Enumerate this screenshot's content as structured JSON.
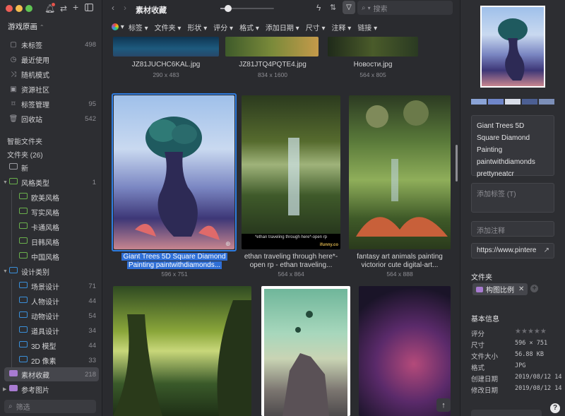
{
  "sidebar": {
    "library_name": "游戏原画",
    "items": [
      {
        "label": "未标签",
        "count": "498"
      },
      {
        "label": "最近使用",
        "count": ""
      },
      {
        "label": "随机模式",
        "count": ""
      },
      {
        "label": "资源社区",
        "count": ""
      },
      {
        "label": "标签管理",
        "count": "95"
      },
      {
        "label": "回收站",
        "count": "542"
      }
    ],
    "smart_folders_label": "智能文件夹",
    "folders_label": "文件夹 (26)",
    "folders": [
      {
        "label": "新",
        "count": ""
      },
      {
        "label": "风格类型",
        "count": "1"
      },
      {
        "label": "欧美风格",
        "count": ""
      },
      {
        "label": "写实风格",
        "count": ""
      },
      {
        "label": "卡通风格",
        "count": ""
      },
      {
        "label": "日韩风格",
        "count": ""
      },
      {
        "label": "中国风格",
        "count": ""
      },
      {
        "label": "设计类别",
        "count": ""
      },
      {
        "label": "场景设计",
        "count": "71"
      },
      {
        "label": "人物设计",
        "count": "44"
      },
      {
        "label": "动物设计",
        "count": "54"
      },
      {
        "label": "道具设计",
        "count": "34"
      },
      {
        "label": "3D 模型",
        "count": "44"
      },
      {
        "label": "2D 像素",
        "count": "33"
      },
      {
        "label": "素材收藏",
        "count": "218"
      },
      {
        "label": "参考图片",
        "count": ""
      }
    ],
    "filter_placeholder": "筛选"
  },
  "toolbar": {
    "title": "素材收藏",
    "search_placeholder": "搜索",
    "zoom_level": 0.15
  },
  "filters": [
    "标签",
    "文件夹",
    "形状",
    "评分",
    "格式",
    "添加日期",
    "尺寸",
    "注释",
    "链接"
  ],
  "grid": {
    "row0": [
      {
        "name": "JZ81JUCHC6KAL.jpg",
        "size": "290 x 483"
      },
      {
        "name": "JZ81JTQ4PQTE4.jpg",
        "size": "834 x 1600"
      },
      {
        "name": "Новости.jpg",
        "size": "564 x 805"
      }
    ],
    "row1": [
      {
        "name_line1": "Giant Trees 5D Square Diamond",
        "name_line2": "Painting paintwithdiamonds...",
        "size": "596 x 751"
      },
      {
        "name_line1": "ethan traveling through here*-",
        "name_line2": "open rp - ethan traveling...",
        "size": "564 x 864"
      },
      {
        "name_line1": "fantasy art animals painting",
        "name_line2": "victorior cute digital-art...",
        "size": "564 x 888"
      }
    ],
    "thumb_caption": "*ethan traveling through here*-open rp",
    "thumb_watermark": "ifunny.co"
  },
  "inspector": {
    "palette": [
      "#8aa3d6",
      "#6f86c9",
      "#d8dde8",
      "#4c5f93",
      "#7c8fb8"
    ],
    "title_text": [
      "Giant Trees 5D",
      "Square Diamond",
      "Painting",
      "paintwithdiamonds",
      "prettyneatcr"
    ],
    "tag_placeholder": "添加标签 (T)",
    "note_placeholder": "添加注释",
    "url": "https://www.pintere",
    "folder_section": "文件夹",
    "folder_chip": "构图比例",
    "info_section": "基本信息",
    "info": [
      {
        "key": "评分",
        "value": ""
      },
      {
        "key": "尺寸",
        "value": "596 × 751"
      },
      {
        "key": "文件大小",
        "value": "56.88 KB"
      },
      {
        "key": "格式",
        "value": "JPG"
      },
      {
        "key": "创建日期",
        "value": "2019/08/12 14"
      },
      {
        "key": "修改日期",
        "value": "2019/08/12 14"
      }
    ],
    "rating": 0
  }
}
